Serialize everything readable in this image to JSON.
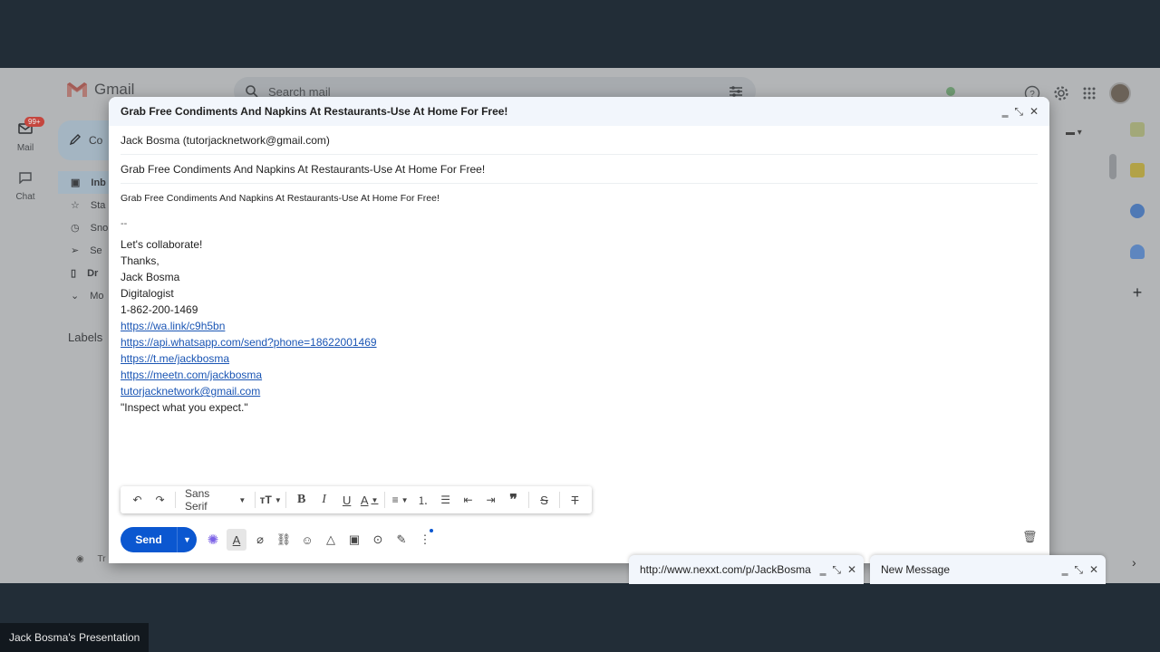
{
  "gmail": {
    "logo_text": "Gmail",
    "search_placeholder": "Search mail",
    "rail": {
      "mail_label": "Mail",
      "mail_badge": "99+",
      "chat_label": "Chat"
    },
    "compose_label": "Co",
    "sidebar_items": [
      "Inb",
      "Sta",
      "Sno",
      "Se",
      "Dr",
      "Mo"
    ],
    "labels_heading": "Labels",
    "upgrade_text": "Tr",
    "colors": {
      "accent": "#0b57d0",
      "badge": "#c5463e"
    }
  },
  "compose": {
    "title": "Grab Free Condiments And Napkins At Restaurants-Use At Home For Free!",
    "from": "Jack Bosma (tutorjacknetwork@gmail.com)",
    "subject": "Grab Free Condiments And Napkins At Restaurants-Use At Home For Free!",
    "body": {
      "first_line": "Grab Free Condiments And Napkins At Restaurants-Use At Home For Free!",
      "sig_dash": "--",
      "lines": [
        "Let's collaborate!",
        "Thanks,",
        "Jack Bosma",
        "Digitalogist",
        "1-862-200-1469"
      ],
      "links": [
        "https://wa.link/c9h5bn",
        "https://api.whatsapp.com/send?phone=18622001469",
        "https://t.me/jackbosma",
        "https://meetn.com/jackbosma",
        "tutorjacknetwork@gmail.com"
      ],
      "quote": "\"Inspect what you expect.\""
    },
    "toolbar": {
      "font": "Sans Serif"
    },
    "send_label": "Send"
  },
  "minimized": [
    {
      "title": "http://www.nexxt.com/p/JackBosma"
    },
    {
      "title": "New Message"
    }
  ],
  "presenter_label": "Jack Bosma's Presentation"
}
